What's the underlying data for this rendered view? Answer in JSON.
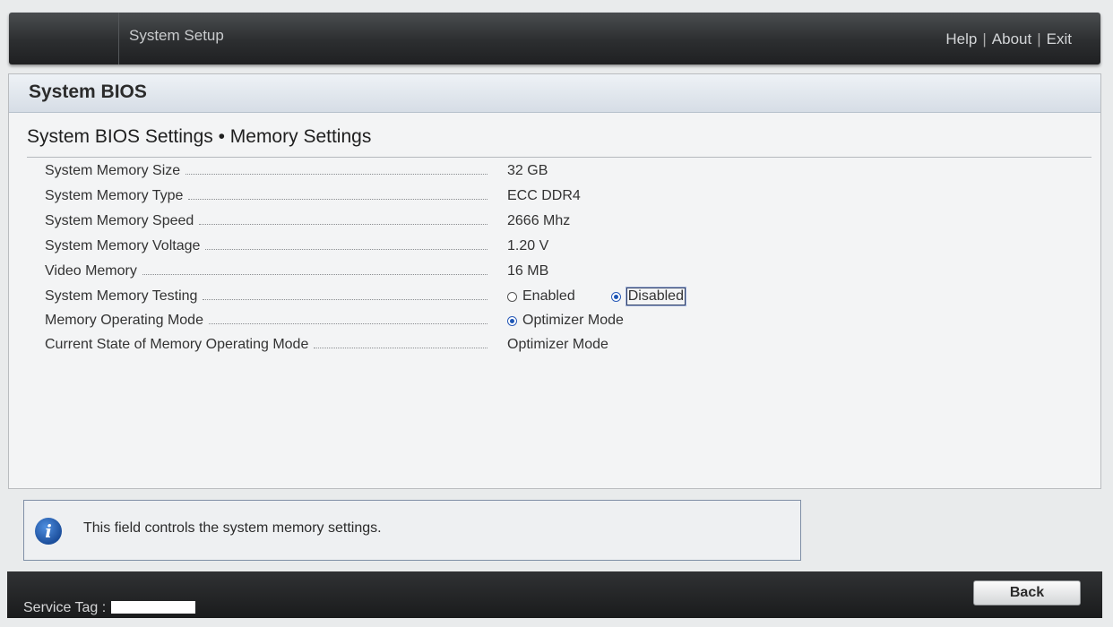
{
  "header": {
    "title": "System Setup",
    "links": {
      "help": "Help",
      "about": "About",
      "exit": "Exit",
      "separator": "|"
    }
  },
  "panel": {
    "title": "System BIOS",
    "breadcrumb": "System BIOS Settings • Memory Settings"
  },
  "settings": [
    {
      "label": "System Memory Size",
      "value": "32 GB"
    },
    {
      "label": "System Memory Type",
      "value": "ECC DDR4"
    },
    {
      "label": "System Memory Speed",
      "value": "2666 Mhz"
    },
    {
      "label": "System Memory Voltage",
      "value": "1.20 V"
    },
    {
      "label": "Video Memory",
      "value": "16 MB"
    },
    {
      "label": "System Memory Testing",
      "options": [
        "Enabled",
        "Disabled"
      ],
      "selected": "Disabled"
    },
    {
      "label": "Memory Operating Mode",
      "options": [
        "Optimizer Mode"
      ],
      "selected": "Optimizer Mode"
    },
    {
      "label": "Current State of Memory Operating Mode",
      "value": "Optimizer Mode"
    }
  ],
  "info": {
    "icon": "info-icon",
    "message": "This field controls the system memory settings."
  },
  "footer": {
    "service_tag_label": "Service Tag :",
    "back_label": "Back"
  },
  "colors": {
    "accent": "#1d56b5",
    "topbar": "#2c2e30",
    "panel_header": "#d6dde6"
  }
}
